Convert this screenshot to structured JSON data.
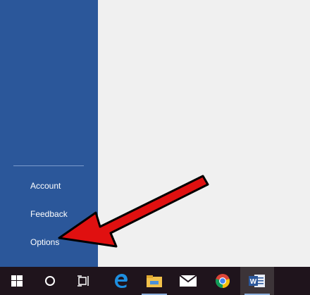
{
  "sidebar": {
    "bg_color": "#2b579a",
    "items": [
      {
        "label": "Account"
      },
      {
        "label": "Feedback"
      },
      {
        "label": "Options"
      }
    ]
  },
  "annotation": {
    "color": "#e01010",
    "points_to": "Options"
  },
  "taskbar": {
    "bg_color": "#1f141c",
    "items": [
      {
        "icon": "windows-start-icon"
      },
      {
        "icon": "cortana-search-icon"
      },
      {
        "icon": "task-view-icon"
      },
      {
        "icon": "edge-icon"
      },
      {
        "icon": "file-explorer-icon"
      },
      {
        "icon": "mail-icon"
      },
      {
        "icon": "chrome-icon"
      },
      {
        "icon": "word-icon",
        "active": true
      }
    ]
  }
}
